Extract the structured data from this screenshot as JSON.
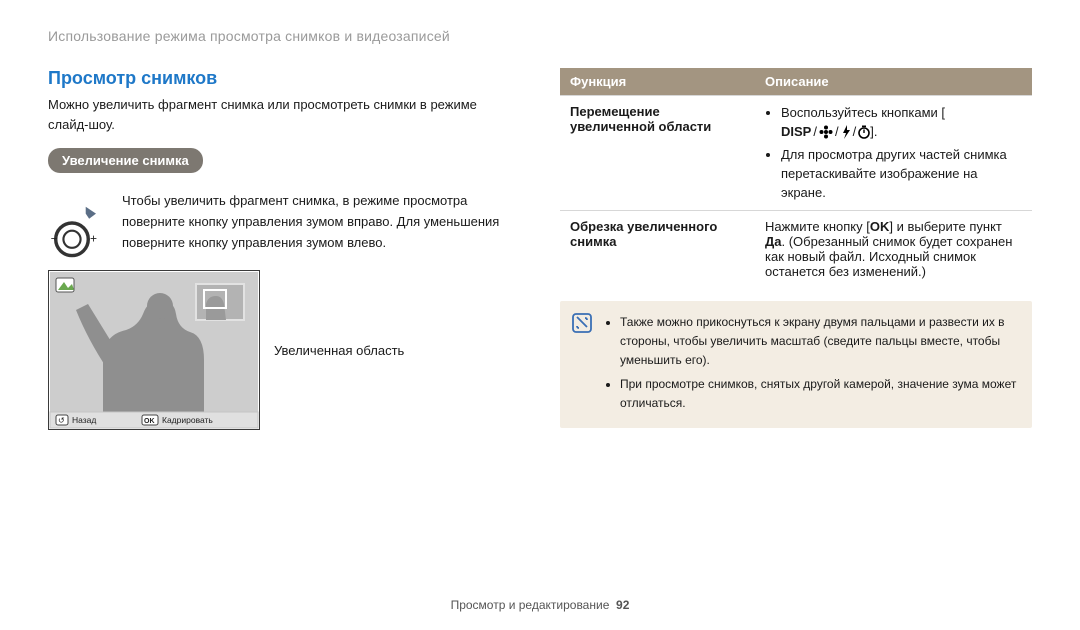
{
  "breadcrumb": "Использование режима просмотра снимков и видеозаписей",
  "section_title": "Просмотр снимков",
  "intro": "Можно увеличить фрагмент снимка или просмотреть снимки в режиме слайд-шоу.",
  "zoom_pill": "Увеличение снимка",
  "zoom_text": "Чтобы увеличить фрагмент снимка, в режиме просмотра поверните кнопку управления зумом вправо. Для уменьшения поверните кнопку управления зумом влево.",
  "enlarged_label": "Увеличенная область",
  "screen": {
    "back": "Назад",
    "crop": "Кадрировать"
  },
  "table": {
    "head_func": "Функция",
    "head_desc": "Описание",
    "row1_name": "Перемещение увеличенной области",
    "row1_bullet1_pre": "Воспользуйтесь кнопками [",
    "row1_bullet1_disp": "DISP",
    "row1_bullet1_post": "].",
    "row1_bullet2": "Для просмотра других частей снимка перетаскивайте изображение на экране.",
    "row2_name": "Обрезка увеличенного снимка",
    "row2_desc_pre": "Нажмите кнопку [",
    "row2_desc_ok": "OK",
    "row2_desc_mid": "] и выберите пункт ",
    "row2_desc_yes": "Да",
    "row2_desc_post": ". (Обрезанный снимок будет сохранен как новый файл. Исходный снимок останется без изменений.)"
  },
  "notes": {
    "n1": "Также можно прикоснуться к экрану двумя пальцами и развести их в стороны, чтобы увеличить масштаб (сведите пальцы вместе, чтобы уменьшить его).",
    "n2": "При просмотре снимков, снятых другой камерой, значение зума может отличаться."
  },
  "footer_text": "Просмотр и редактирование",
  "footer_page": "92"
}
